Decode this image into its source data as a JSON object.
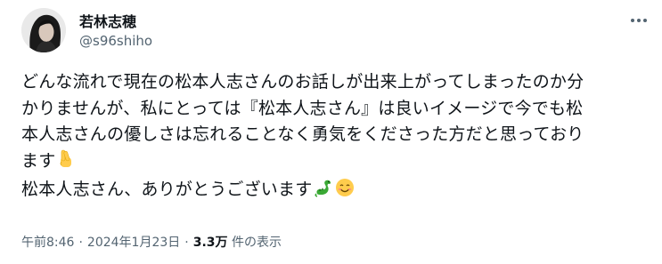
{
  "author": {
    "display_name": "若林志穂",
    "handle": "@s96shiho",
    "avatar_icon": "profile-photo"
  },
  "tweet": {
    "lines": [
      "どんな流れで現在の松本人志さんのお話しが出来上がってしまったのか分",
      "かりませんが、私にとっては『松本人志さん』は良いイメージで今でも松",
      "本人志さんの優しさは忘れることなく勇気をくださった方だと思っており",
      "ます",
      "松本人志さん、ありがとうございます"
    ],
    "emojis": [
      "fingers-crossed-icon",
      "dragon-icon",
      "smiling-face-icon"
    ]
  },
  "meta": {
    "time": "午前8:46",
    "separator": "·",
    "date": "2024年1月23日",
    "views_count": "3.3万",
    "views_label": "件の表示"
  },
  "colors": {
    "primary_text": "#0f1419",
    "secondary_text": "#536471",
    "background": "#ffffff"
  }
}
